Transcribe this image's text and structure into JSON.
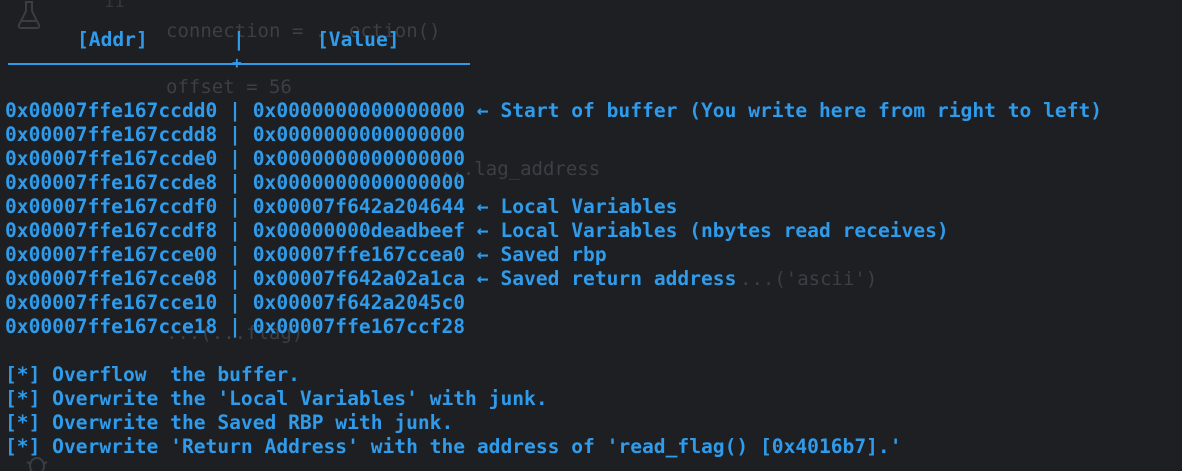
{
  "header": {
    "addr_label": "[Addr]",
    "separator": "|",
    "value_label": "[Value]",
    "rule_junction": "+"
  },
  "stack_rows": [
    {
      "addr": "0x00007ffe167ccdd0",
      "sep": "|",
      "value": "0x0000000000000000",
      "note": "← Start of buffer (You write here from right to left)"
    },
    {
      "addr": "0x00007ffe167ccdd8",
      "sep": "|",
      "value": "0x0000000000000000",
      "note": ""
    },
    {
      "addr": "0x00007ffe167ccde0",
      "sep": "|",
      "value": "0x0000000000000000",
      "note": ""
    },
    {
      "addr": "0x00007ffe167ccde8",
      "sep": "|",
      "value": "0x0000000000000000",
      "note": ""
    },
    {
      "addr": "0x00007ffe167ccdf0",
      "sep": "|",
      "value": "0x00007f642a204644",
      "note": "← Local Variables"
    },
    {
      "addr": "0x00007ffe167ccdf8",
      "sep": "|",
      "value": "0x00000000deadbeef",
      "note": "← Local Variables (nbytes read receives)"
    },
    {
      "addr": "0x00007ffe167cce00",
      "sep": "|",
      "value": "0x00007ffe167ccea0",
      "note": "← Saved rbp"
    },
    {
      "addr": "0x00007ffe167cce08",
      "sep": "|",
      "value": "0x00007f642a02a1ca",
      "note": "← Saved return address"
    },
    {
      "addr": "0x00007ffe167cce10",
      "sep": "|",
      "value": "0x00007f642a2045c0",
      "note": ""
    },
    {
      "addr": "0x00007ffe167cce18",
      "sep": "|",
      "value": "0x00007ffe167ccf28",
      "note": ""
    }
  ],
  "instructions": [
    "[*] Overflow  the buffer.",
    "[*] Overwrite the 'Local Variables' with junk.",
    "[*] Overwrite the Saved RBP with junk.",
    "[*] Overwrite 'Return Address' with the address of 'read_flag() [0x4016b7].'"
  ],
  "background_editor": {
    "line_number": "11",
    "lines": [
      "connection = ...ection()",
      "offset = 56",
      "...lag_address",
      "...('ascii')",
      "...(...flag)"
    ]
  },
  "colors": {
    "background": "#1d1f23",
    "text": "#2f9bea",
    "ghost_text": "#3b3f46"
  },
  "icons": [
    "flask-icon",
    "bug-icon"
  ]
}
